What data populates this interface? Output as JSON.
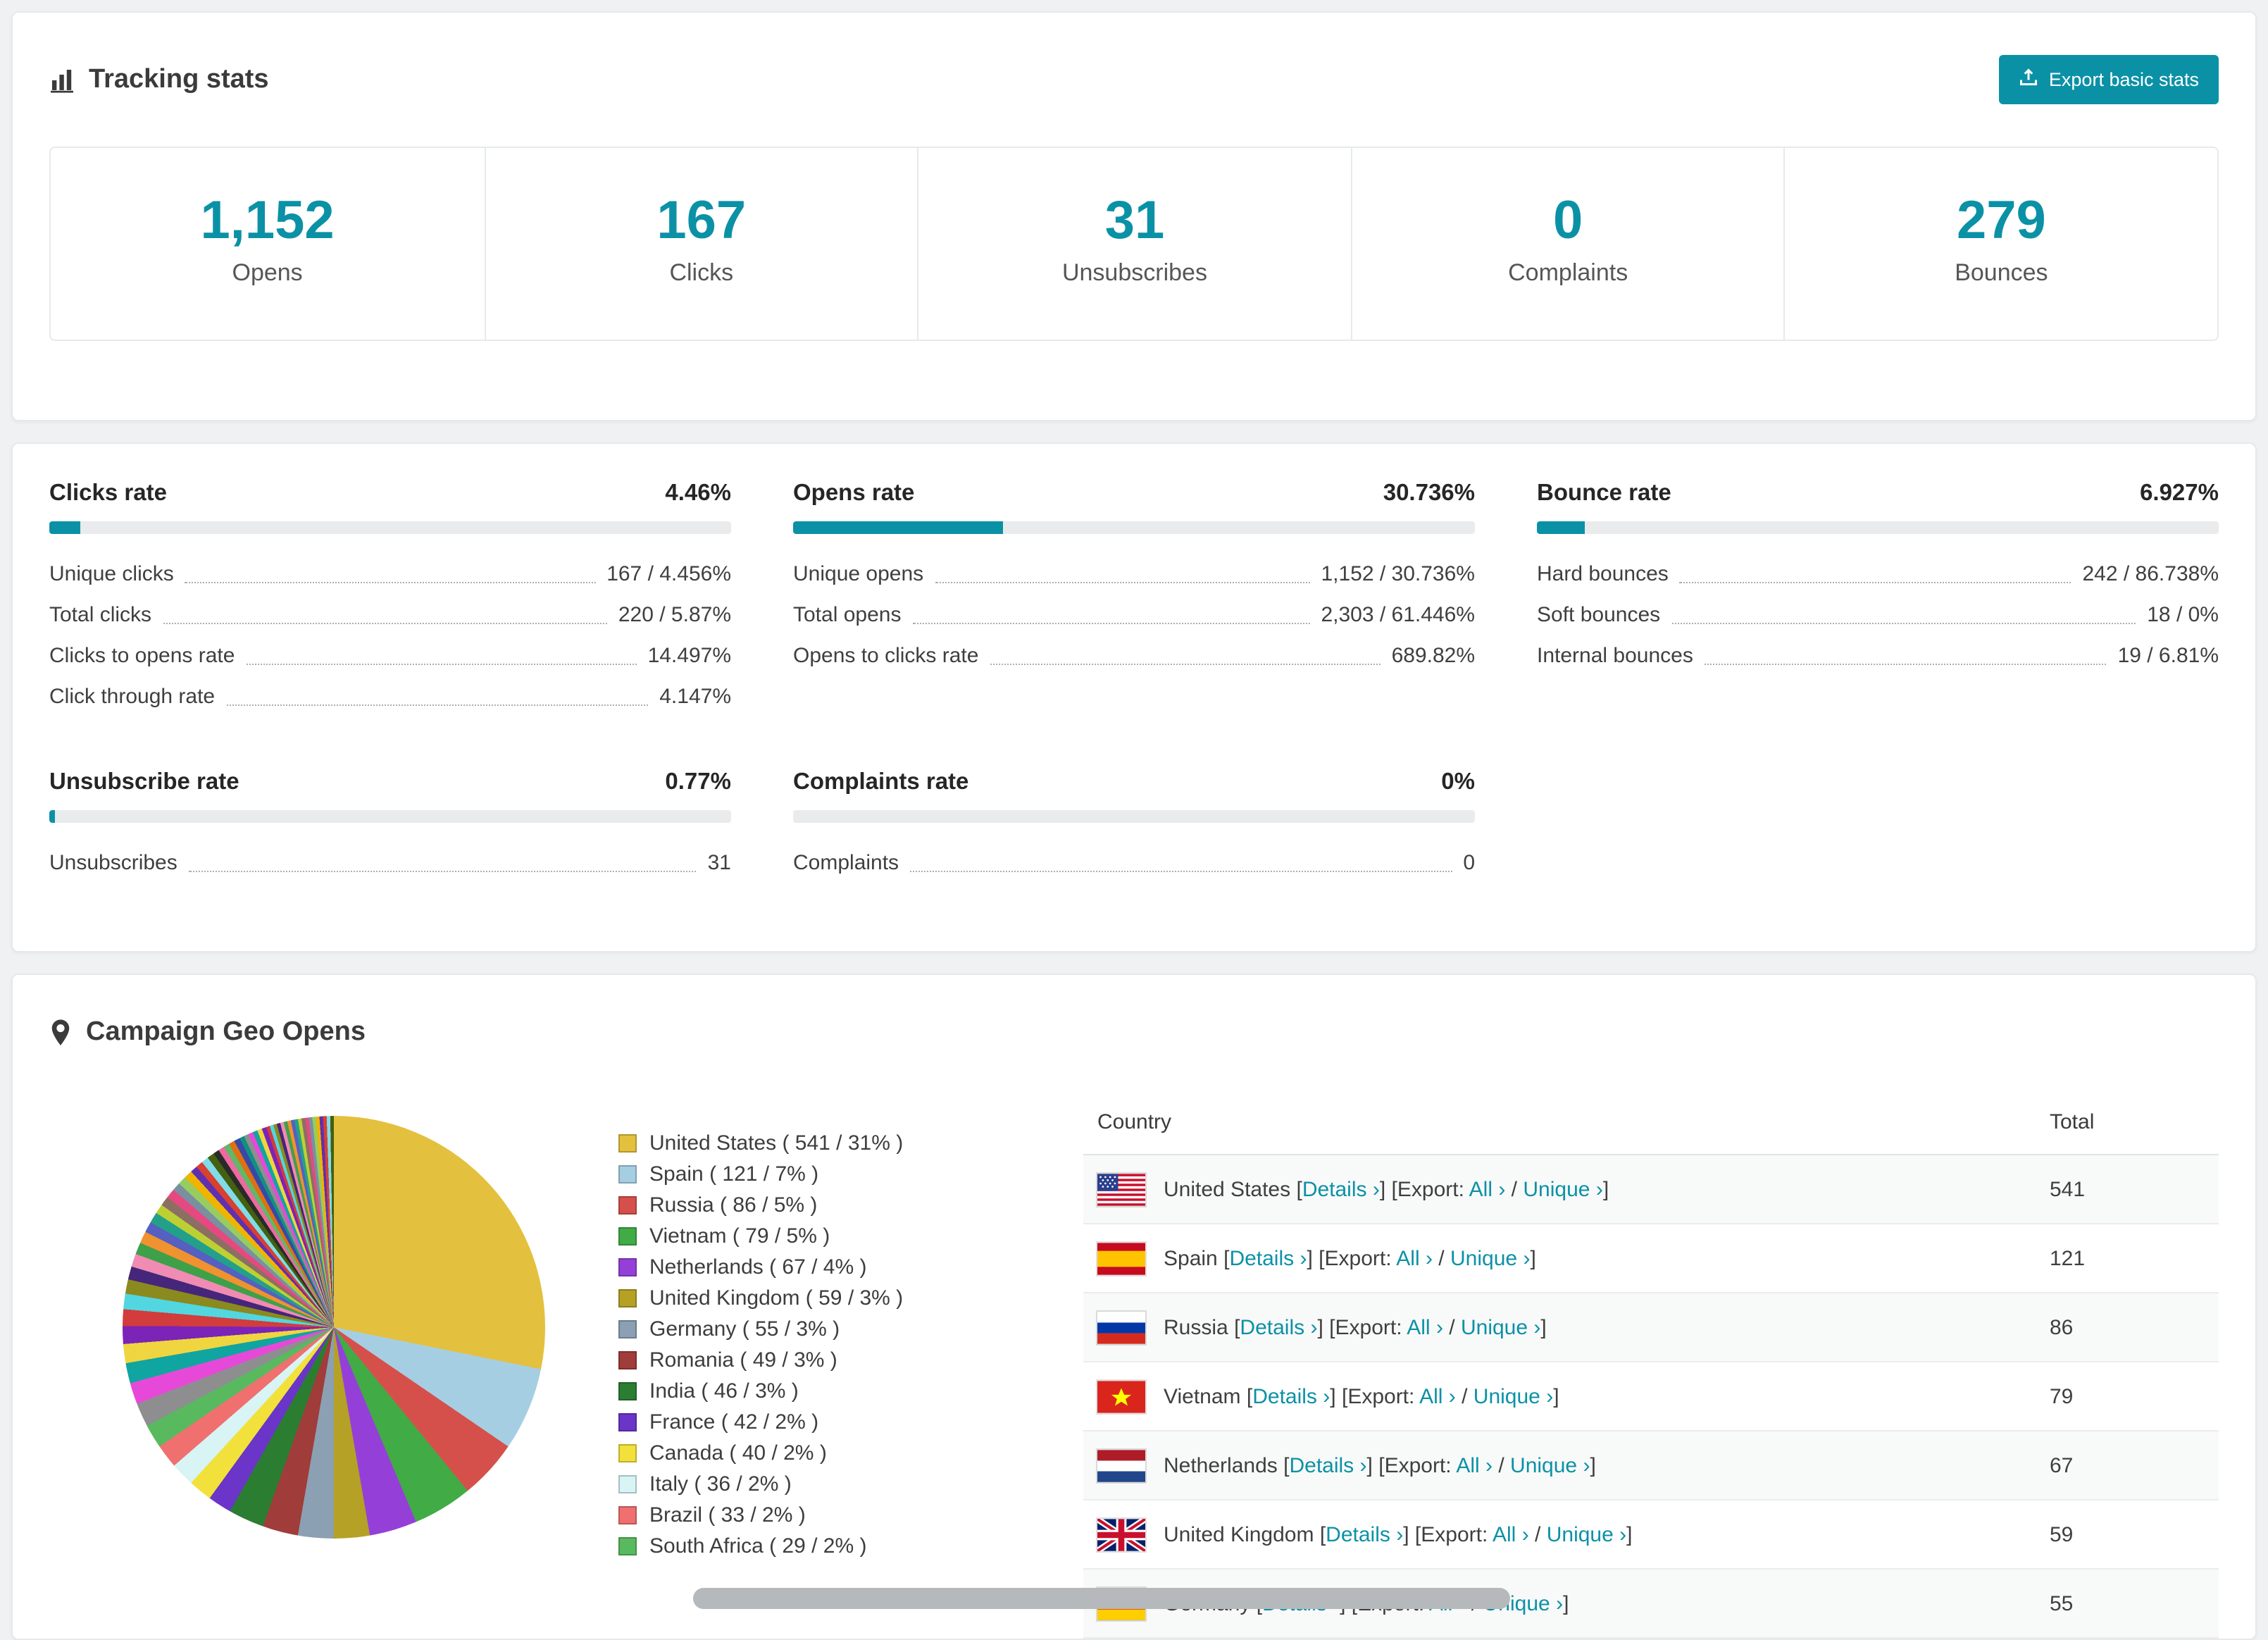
{
  "accent": "#0b91a6",
  "tracking": {
    "title": "Tracking stats",
    "export_button": "Export basic stats",
    "stats": [
      {
        "value": "1,152",
        "label": "Opens"
      },
      {
        "value": "167",
        "label": "Clicks"
      },
      {
        "value": "31",
        "label": "Unsubscribes"
      },
      {
        "value": "0",
        "label": "Complaints"
      },
      {
        "value": "279",
        "label": "Bounces"
      }
    ]
  },
  "rates": [
    {
      "title": "Clicks rate",
      "percent": "4.46%",
      "bar_percent": 4.46,
      "rows": [
        {
          "label": "Unique clicks",
          "value": "167 / 4.456%"
        },
        {
          "label": "Total clicks",
          "value": "220 / 5.87%"
        },
        {
          "label": "Clicks to opens rate",
          "value": "14.497%"
        },
        {
          "label": "Click through rate",
          "value": "4.147%"
        }
      ]
    },
    {
      "title": "Opens rate",
      "percent": "30.736%",
      "bar_percent": 30.736,
      "rows": [
        {
          "label": "Unique opens",
          "value": "1,152 / 30.736%"
        },
        {
          "label": "Total opens",
          "value": "2,303 / 61.446%"
        },
        {
          "label": "Opens to clicks rate",
          "value": "689.82%"
        }
      ]
    },
    {
      "title": "Bounce rate",
      "percent": "6.927%",
      "bar_percent": 6.927,
      "rows": [
        {
          "label": "Hard bounces",
          "value": "242 / 86.738%"
        },
        {
          "label": "Soft bounces",
          "value": "18 / 0%"
        },
        {
          "label": "Internal bounces",
          "value": "19 / 6.81%"
        }
      ]
    },
    {
      "title": "Unsubscribe rate",
      "percent": "0.77%",
      "bar_percent": 0.77,
      "rows": [
        {
          "label": "Unsubscribes",
          "value": "31"
        }
      ]
    },
    {
      "title": "Complaints rate",
      "percent": "0%",
      "bar_percent": 0,
      "rows": [
        {
          "label": "Complaints",
          "value": "0"
        }
      ]
    }
  ],
  "geo": {
    "title": "Campaign Geo Opens",
    "links": {
      "details": "Details",
      "export": "Export:",
      "all": "All",
      "unique": "Unique",
      "chevron": "›"
    },
    "table": {
      "headers": [
        "Country",
        "Total"
      ],
      "rows": [
        {
          "country": "United States",
          "total": "541",
          "flag": "us"
        },
        {
          "country": "Spain",
          "total": "121",
          "flag": "es"
        },
        {
          "country": "Russia",
          "total": "86",
          "flag": "ru"
        },
        {
          "country": "Vietnam",
          "total": "79",
          "flag": "vn"
        },
        {
          "country": "Netherlands",
          "total": "67",
          "flag": "nl"
        },
        {
          "country": "United Kingdom",
          "total": "59",
          "flag": "gb"
        },
        {
          "country": "Germany",
          "total": "55",
          "flag": "de"
        }
      ]
    }
  },
  "chart_data": {
    "type": "pie",
    "title": "Campaign Geo Opens",
    "legend_position": "right",
    "segments": [
      {
        "label": "United States",
        "count": 541,
        "percent": 31,
        "color": "#e4c03f"
      },
      {
        "label": "Spain",
        "count": 121,
        "percent": 7,
        "color": "#a6cee3"
      },
      {
        "label": "Russia",
        "count": 86,
        "percent": 5,
        "color": "#d6504b"
      },
      {
        "label": "Vietnam",
        "count": 79,
        "percent": 5,
        "color": "#41ab45"
      },
      {
        "label": "Netherlands",
        "count": 67,
        "percent": 4,
        "color": "#9440d8"
      },
      {
        "label": "United Kingdom",
        "count": 59,
        "percent": 3,
        "color": "#b5a126"
      },
      {
        "label": "Germany",
        "count": 55,
        "percent": 3,
        "color": "#8ba0b2"
      },
      {
        "label": "Romania",
        "count": 49,
        "percent": 3,
        "color": "#a03c3a"
      },
      {
        "label": "India",
        "count": 46,
        "percent": 3,
        "color": "#2b7d32"
      },
      {
        "label": "France",
        "count": 42,
        "percent": 2,
        "color": "#6a35c8"
      },
      {
        "label": "Canada",
        "count": 40,
        "percent": 2,
        "color": "#f2e13a"
      },
      {
        "label": "Italy",
        "count": 36,
        "percent": 2,
        "color": "#d8f4f4"
      },
      {
        "label": "Brazil",
        "count": 33,
        "percent": 2,
        "color": "#f07070"
      },
      {
        "label": "South Africa",
        "count": 29,
        "percent": 2,
        "color": "#59b95e"
      }
    ],
    "other_values": [
      2.0,
      1.8,
      1.7,
      1.6,
      1.5,
      1.4,
      1.3,
      1.2,
      1.1,
      1.1,
      1.0,
      1.0,
      0.9,
      0.9,
      0.8,
      0.8,
      0.8,
      0.7,
      0.7,
      0.7,
      0.6,
      0.6,
      0.6,
      0.6,
      0.5,
      0.5,
      0.5,
      0.5,
      0.5,
      0.4,
      0.4,
      0.4,
      0.4,
      0.4,
      0.4,
      0.3,
      0.3,
      0.3,
      0.3,
      0.3,
      0.3,
      0.3,
      0.3,
      0.3,
      0.3,
      0.3,
      0.3,
      0.3,
      0.3,
      0.3,
      0.3,
      0.3,
      0.3,
      0.3
    ],
    "other_colors": [
      "#8e8e90",
      "#e649d8",
      "#10a5a0",
      "#efd53f",
      "#7c23b8",
      "#d23c3c",
      "#52d6e0",
      "#8a8a1f",
      "#45267a",
      "#f08bb4",
      "#3fa04a",
      "#f0922f",
      "#5560c0",
      "#23a08a",
      "#bcd034",
      "#8d6e63",
      "#e64980",
      "#7890a0",
      "#98cc60",
      "#f0b400",
      "#6030b0",
      "#d84030",
      "#80dce8",
      "#446010",
      "#2a2a2a",
      "#f068a0",
      "#60b868",
      "#e07010",
      "#3848a8",
      "#109080"
    ]
  }
}
